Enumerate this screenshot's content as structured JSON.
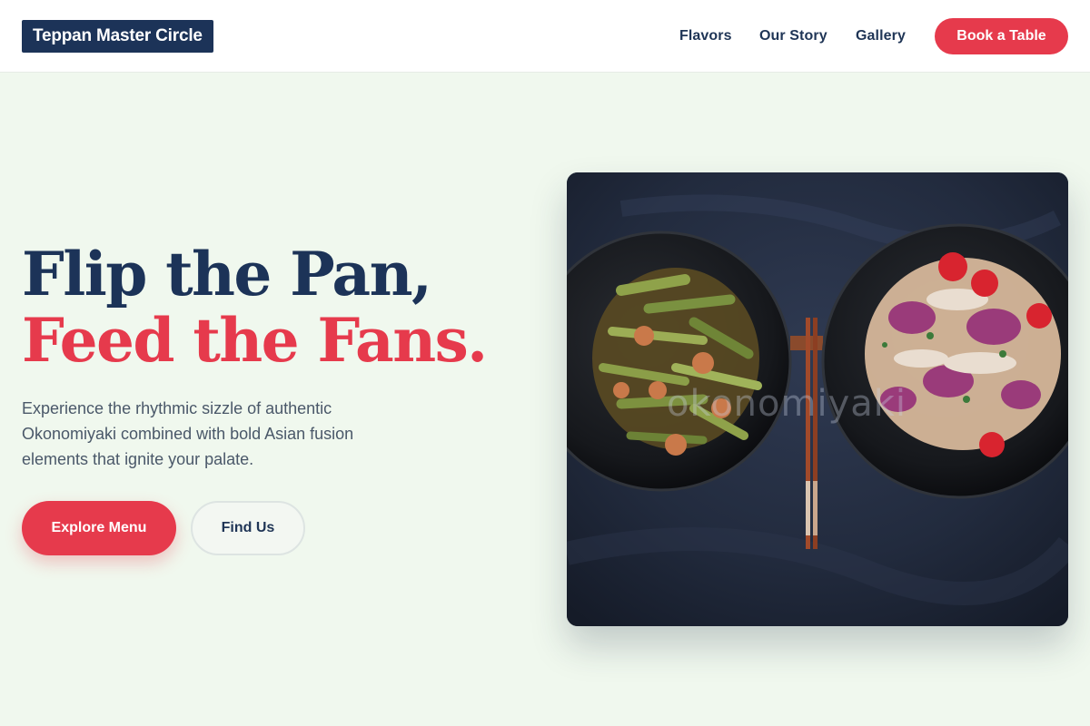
{
  "header": {
    "logo": "Teppan Master Circle",
    "nav": [
      "Flavors",
      "Our Story",
      "Gallery"
    ],
    "cta": "Book a Table"
  },
  "hero": {
    "headline_line1": "Flip the Pan,",
    "headline_line2": "Feed the Fans.",
    "description": "Experience the rhythmic sizzle of authentic Okonomiyaki combined with bold Asian fusion elements that ignite your palate.",
    "primary_button": "Explore Menu",
    "secondary_button": "Find Us"
  },
  "image": {
    "watermark": "okonomiyaki"
  },
  "colors": {
    "navy": "#1c3358",
    "accent_red": "#e63a4c",
    "background": "#f0f8ee"
  }
}
